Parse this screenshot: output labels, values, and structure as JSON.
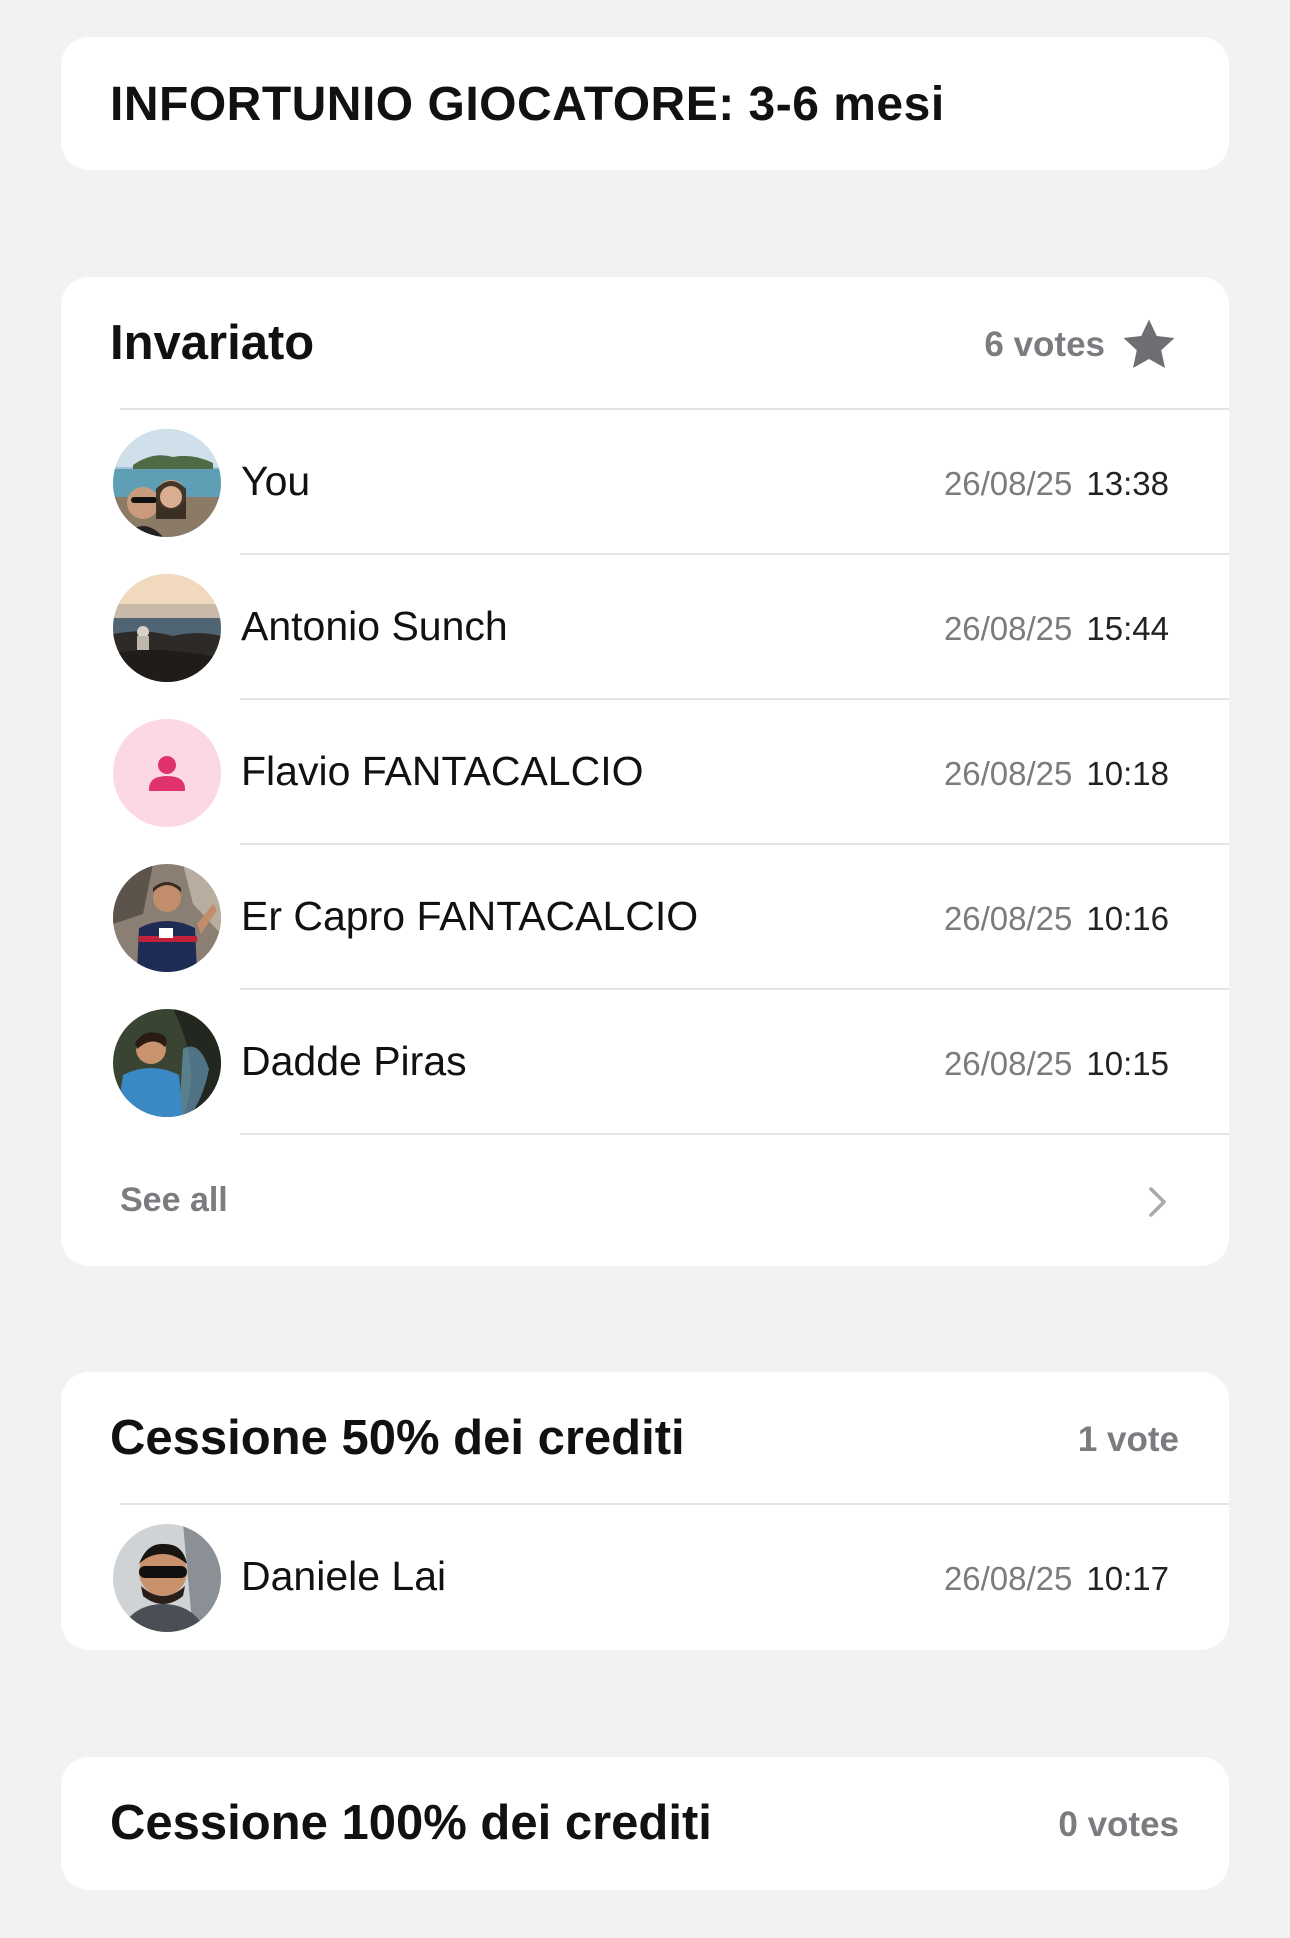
{
  "question": {
    "text": "INFORTUNIO GIOCATORE: 3-6 mesi"
  },
  "options": [
    {
      "title": "Invariato",
      "votes_label": "6 votes",
      "selected_icon": "star-icon",
      "voters": [
        {
          "name": "You",
          "date": "26/08/25",
          "time": "13:38",
          "avatar": "photo-sea-couple"
        },
        {
          "name": "Antonio Sunch",
          "date": "26/08/25",
          "time": "15:44",
          "avatar": "photo-sunset-rocks"
        },
        {
          "name": "Flavio FANTACALCIO",
          "date": "26/08/25",
          "time": "10:18",
          "avatar": "person-placeholder-icon"
        },
        {
          "name": "Er Capro FANTACALCIO",
          "date": "26/08/25",
          "time": "10:16",
          "avatar": "photo-jersey"
        },
        {
          "name": "Dadde Piras",
          "date": "26/08/25",
          "time": "10:15",
          "avatar": "photo-cave"
        }
      ],
      "see_all_label": "See all"
    },
    {
      "title": "Cessione 50% dei crediti",
      "votes_label": "1 vote",
      "voters": [
        {
          "name": "Daniele Lai",
          "date": "26/08/25",
          "time": "10:17",
          "avatar": "photo-sunglasses"
        }
      ]
    },
    {
      "title": "Cessione 100% dei crediti",
      "votes_label": "0 votes",
      "voters": []
    }
  ],
  "colors": {
    "background": "#f2f2f4",
    "card": "#ffffff",
    "secondary_text": "#7b7b80",
    "placeholder_avatar_bg": "#fcd7e6",
    "placeholder_avatar_icon": "#e0336e"
  }
}
